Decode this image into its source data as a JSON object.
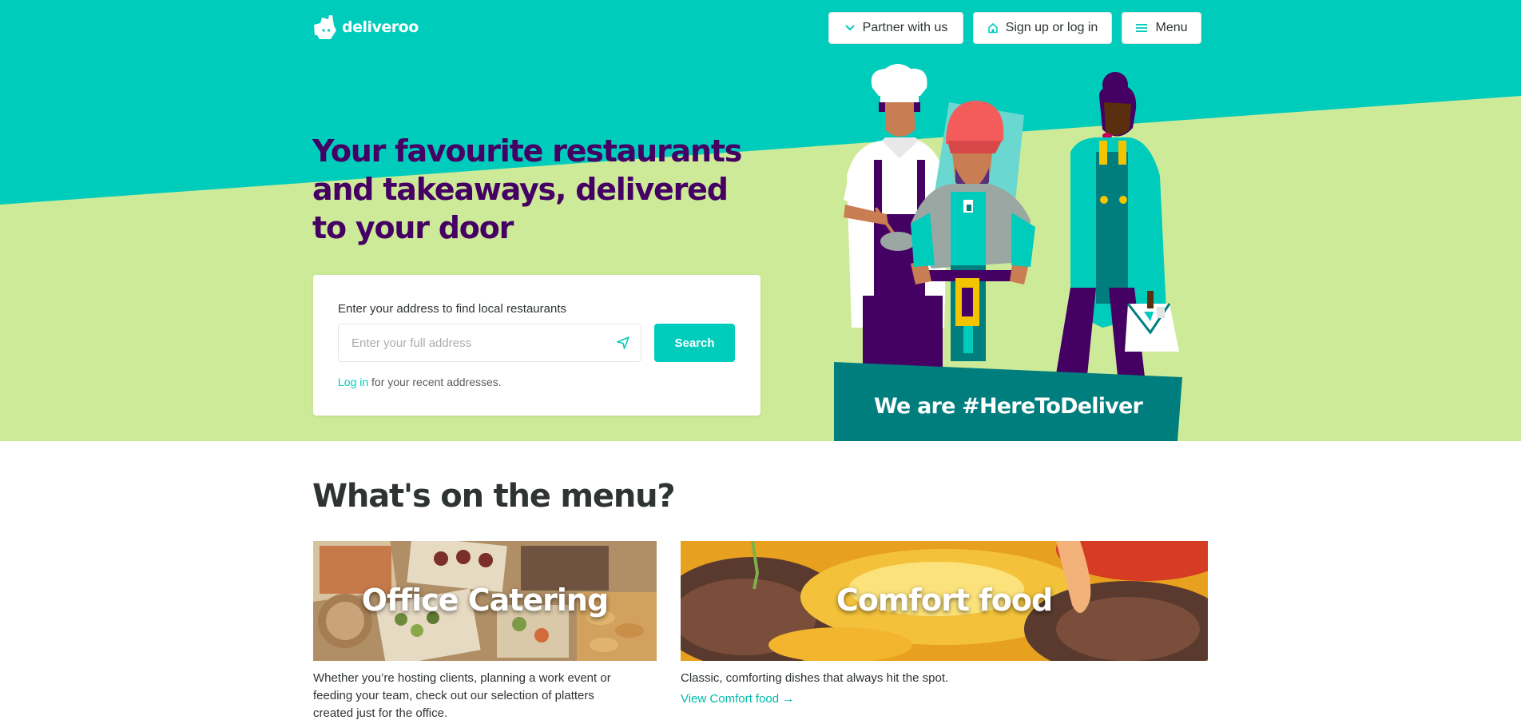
{
  "brand": {
    "name": "deliveroo",
    "logo_icon": "kangaroo-icon",
    "teal": "#00ccbc",
    "purple": "#440063",
    "lime": "#cdea98"
  },
  "header": {
    "partner_button": {
      "label": "Partner with us",
      "icon": "chevron-down-icon"
    },
    "signup_button": {
      "label": "Sign up or log in",
      "icon": "home-icon"
    },
    "menu_button": {
      "label": "Menu",
      "icon": "hamburger-icon"
    }
  },
  "hero": {
    "title": "Your favourite restaurants and takeaways, delivered to your door",
    "search": {
      "label": "Enter your address to find local restaurants",
      "placeholder": "Enter your full address",
      "value": "",
      "locate_icon": "location-arrow-icon",
      "button_label": "Search",
      "login_link": "Log in",
      "login_suffix": " for your recent addresses."
    },
    "banner_text": "We are #HereToDeliver"
  },
  "menu_section": {
    "title": "What's on the menu?",
    "cards": [
      {
        "caption": "Office Catering",
        "description": "Whether you’re hosting clients, planning a work event or feeding your team, check out our selection of platters created just for the office."
      },
      {
        "caption": "Comfort food",
        "description": "Classic, comforting dishes that always hit the spot.",
        "link": "View Comfort food →"
      }
    ]
  }
}
